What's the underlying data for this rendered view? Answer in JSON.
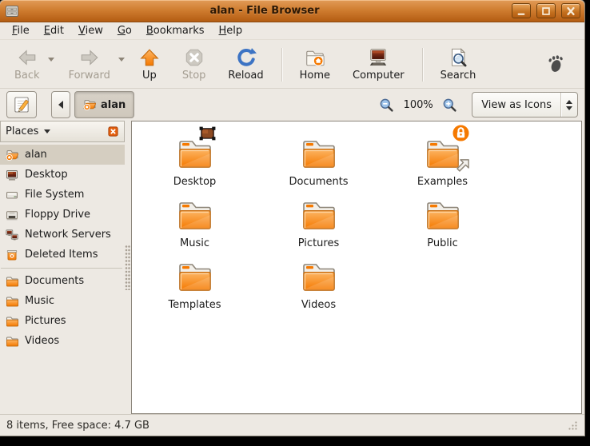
{
  "window": {
    "title": "alan - File Browser"
  },
  "menubar": {
    "items": [
      {
        "label": "File"
      },
      {
        "label": "Edit"
      },
      {
        "label": "View"
      },
      {
        "label": "Go"
      },
      {
        "label": "Bookmarks"
      },
      {
        "label": "Help"
      }
    ]
  },
  "toolbar": {
    "back": {
      "label": "Back",
      "enabled": false
    },
    "forward": {
      "label": "Forward",
      "enabled": false
    },
    "up": {
      "label": "Up",
      "enabled": true
    },
    "stop": {
      "label": "Stop",
      "enabled": false
    },
    "reload": {
      "label": "Reload",
      "enabled": true
    },
    "home": {
      "label": "Home",
      "enabled": true
    },
    "computer": {
      "label": "Computer",
      "enabled": true
    },
    "search": {
      "label": "Search",
      "enabled": true
    }
  },
  "locationbar": {
    "path_button": "alan",
    "zoom_level": "100%",
    "view_mode": "View as Icons"
  },
  "sidebar": {
    "header": "Places",
    "items": [
      {
        "label": "alan",
        "icon": "home-folder-sm",
        "selected": true
      },
      {
        "label": "Desktop",
        "icon": "desktop-mini"
      },
      {
        "label": "File System",
        "icon": "drive"
      },
      {
        "label": "Floppy Drive",
        "icon": "floppy"
      },
      {
        "label": "Network Servers",
        "icon": "network"
      },
      {
        "label": "Deleted Items",
        "icon": "trash",
        "separator_after": true
      },
      {
        "label": "Documents",
        "icon": "folder-sm"
      },
      {
        "label": "Music",
        "icon": "folder-sm"
      },
      {
        "label": "Pictures",
        "icon": "folder-sm"
      },
      {
        "label": "Videos",
        "icon": "folder-sm"
      }
    ]
  },
  "files": {
    "items": [
      {
        "label": "Desktop",
        "icon": "folder",
        "emblems": [
          "desktop"
        ]
      },
      {
        "label": "Documents",
        "icon": "folder",
        "emblems": []
      },
      {
        "label": "Examples",
        "icon": "folder",
        "emblems": [
          "lock",
          "symlink"
        ]
      },
      {
        "label": "Music",
        "icon": "folder",
        "emblems": []
      },
      {
        "label": "Pictures",
        "icon": "folder",
        "emblems": []
      },
      {
        "label": "Public",
        "icon": "folder",
        "emblems": []
      },
      {
        "label": "Templates",
        "icon": "folder",
        "emblems": []
      },
      {
        "label": "Videos",
        "icon": "folder",
        "emblems": []
      }
    ]
  },
  "statusbar": {
    "text": "8 items, Free space: 4.7 GB"
  },
  "colors": {
    "accent_orange": "#F57900",
    "titlebar_top": "#E29B58",
    "titlebar_bottom": "#B35C12",
    "selection": "#D5CEC1",
    "chrome_bg": "#EDE9E3"
  }
}
